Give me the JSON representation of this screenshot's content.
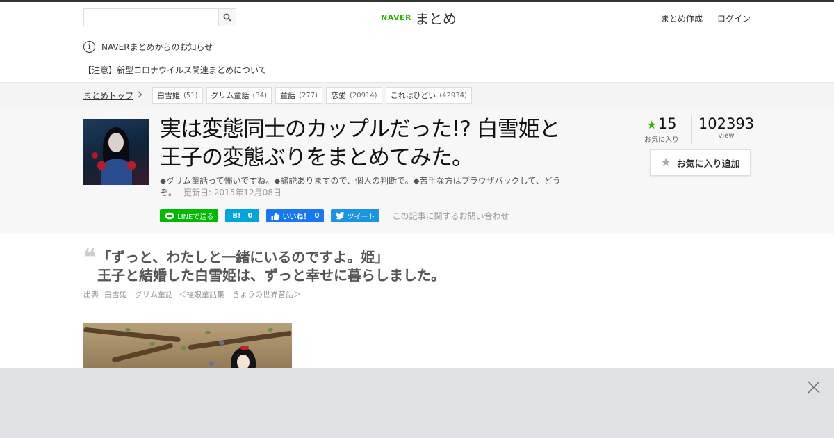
{
  "header": {
    "search_placeholder": "",
    "logo_brand": "NAVER",
    "logo_text": "まとめ",
    "create_link": "まとめ作成",
    "login_link": "ログイン"
  },
  "notice": {
    "info_glyph": "i",
    "title": "NAVERまとめからのお知らせ",
    "link_text": "【注意】新型コロナウイルス関連まとめについて"
  },
  "breadcrumb": {
    "top_label": "まとめトップ",
    "tags": [
      {
        "label": "白雪姫",
        "count": "(51)"
      },
      {
        "label": "グリム童話",
        "count": "(34)"
      },
      {
        "label": "童話",
        "count": "(277)"
      },
      {
        "label": "恋愛",
        "count": "(20914)"
      },
      {
        "label": "これはひどい",
        "count": "(42934)"
      }
    ]
  },
  "article": {
    "title": "実は変態同士のカップルだった!? 白雪姫と王子の変態ぶりをまとめてみた。",
    "description": "◆グリム童話って怖いですね。◆諸説ありますので、個人の判断で。◆苦手な方はブラウザバックして、どうぞ。",
    "updated": "更新日: 2015年12月08日",
    "share": {
      "line": "LINEで送る",
      "hatena_icon": "B!",
      "hatena_count": "0",
      "fb_label": "いいね！",
      "fb_count": "0",
      "tweet": "ツイート"
    },
    "contact": "この記事に関するお問い合わせ"
  },
  "stats": {
    "favorites": "15",
    "favorites_label": "お気に入り",
    "views": "102393",
    "views_label": "view",
    "fav_button": "お気に入り追加"
  },
  "quote": {
    "mark": "❝",
    "line1": "「ずっと、わたしと一緒にいるのですよ。姫」",
    "line2": "王子と結婚した白雪姫は、ずっと幸せに暮らしました。"
  },
  "source": {
    "label": "出典",
    "items": [
      "白雪姫　グリム童話",
      "＜福娘童話集　きょうの世界昔話＞"
    ]
  },
  "colors": {
    "accent_green": "#2db400",
    "line_green": "#00b900",
    "hatena_blue": "#00a4de",
    "facebook_blue": "#1877f2",
    "twitter_blue": "#1b95e0"
  }
}
